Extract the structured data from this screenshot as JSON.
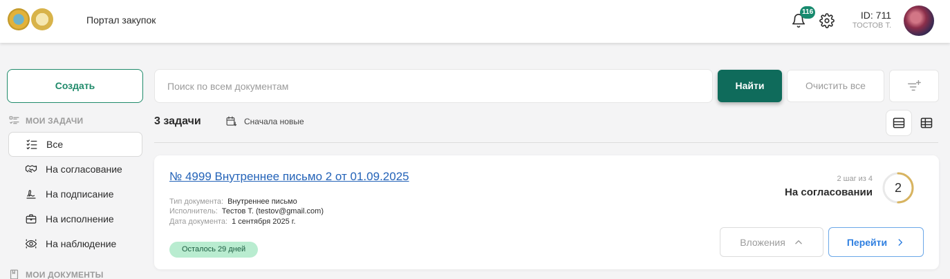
{
  "header": {
    "title": "Портал закупок",
    "notifications_count": "116",
    "user_id": "ID: 711",
    "user_name": "ТОСТОВ Т."
  },
  "sidebar": {
    "create_label": "Создать",
    "tasks_section": "МОИ ЗАДАЧИ",
    "items": [
      {
        "label": "Все",
        "icon": "list-icon",
        "active": true
      },
      {
        "label": "На согласование",
        "icon": "handshake-icon"
      },
      {
        "label": "На подписание",
        "icon": "signature-icon"
      },
      {
        "label": "На исполнение",
        "icon": "briefcase-icon"
      },
      {
        "label": "На наблюдение",
        "icon": "eye-icon"
      }
    ],
    "documents_section": "МОИ ДОКУМЕНТЫ"
  },
  "search": {
    "placeholder": "Поиск по всем документам",
    "find_label": "Найти",
    "clear_label": "Очистить все"
  },
  "toolbar": {
    "count": "3 задачи",
    "sort_label": "Сначала новые"
  },
  "task": {
    "title": "№ 4999 Внутреннее письмо 2 от 01.09.2025",
    "doc_type_label": "Тип документа:",
    "doc_type": "Внутреннее письмо",
    "executor_label": "Исполнитель:",
    "executor": "Тестов Т. (testov@gmail.com)",
    "date_label": "Дата документа:",
    "date": "1 сентября 2025 г.",
    "remaining": "Осталось 29 дней",
    "step_text": "2 шаг из 4",
    "status": "На согласовании",
    "step_number": "2",
    "step_progress": 0.5,
    "attachments_label": "Вложения",
    "go_label": "Перейти"
  },
  "colors": {
    "primary": "#0f6b5b",
    "accent_green": "#1f8a6a",
    "link_blue": "#2463b8",
    "progress_gold": "#d8b460"
  }
}
